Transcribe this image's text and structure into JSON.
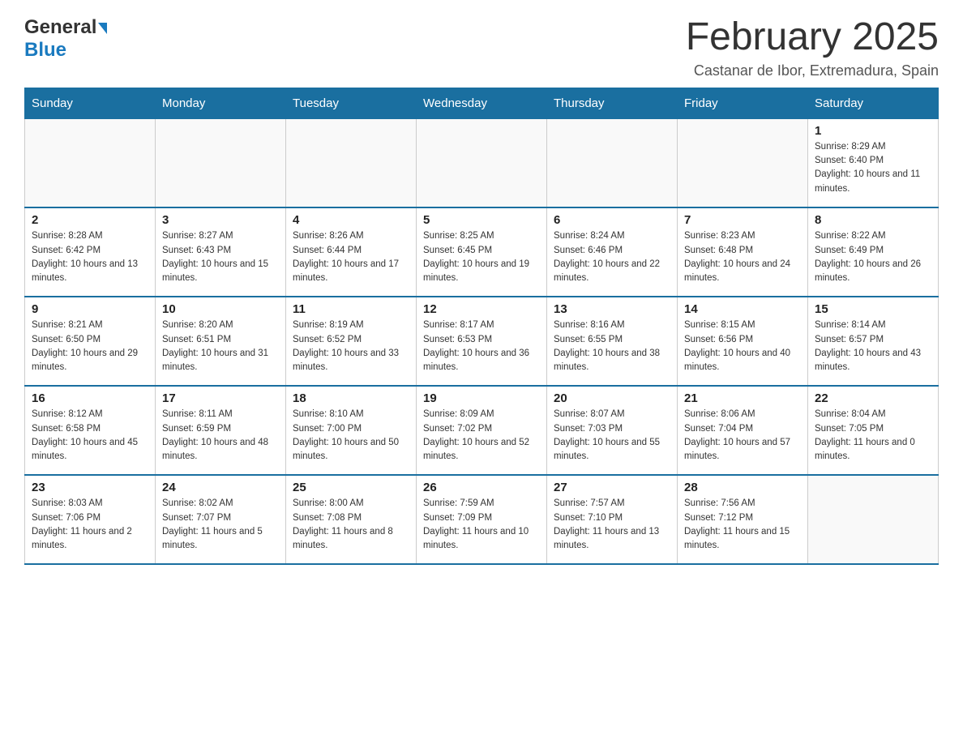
{
  "header": {
    "logo_general": "General",
    "logo_blue": "Blue",
    "title": "February 2025",
    "subtitle": "Castanar de Ibor, Extremadura, Spain"
  },
  "weekdays": [
    "Sunday",
    "Monday",
    "Tuesday",
    "Wednesday",
    "Thursday",
    "Friday",
    "Saturday"
  ],
  "weeks": [
    [
      {
        "day": "",
        "info": ""
      },
      {
        "day": "",
        "info": ""
      },
      {
        "day": "",
        "info": ""
      },
      {
        "day": "",
        "info": ""
      },
      {
        "day": "",
        "info": ""
      },
      {
        "day": "",
        "info": ""
      },
      {
        "day": "1",
        "info": "Sunrise: 8:29 AM\nSunset: 6:40 PM\nDaylight: 10 hours and 11 minutes."
      }
    ],
    [
      {
        "day": "2",
        "info": "Sunrise: 8:28 AM\nSunset: 6:42 PM\nDaylight: 10 hours and 13 minutes."
      },
      {
        "day": "3",
        "info": "Sunrise: 8:27 AM\nSunset: 6:43 PM\nDaylight: 10 hours and 15 minutes."
      },
      {
        "day": "4",
        "info": "Sunrise: 8:26 AM\nSunset: 6:44 PM\nDaylight: 10 hours and 17 minutes."
      },
      {
        "day": "5",
        "info": "Sunrise: 8:25 AM\nSunset: 6:45 PM\nDaylight: 10 hours and 19 minutes."
      },
      {
        "day": "6",
        "info": "Sunrise: 8:24 AM\nSunset: 6:46 PM\nDaylight: 10 hours and 22 minutes."
      },
      {
        "day": "7",
        "info": "Sunrise: 8:23 AM\nSunset: 6:48 PM\nDaylight: 10 hours and 24 minutes."
      },
      {
        "day": "8",
        "info": "Sunrise: 8:22 AM\nSunset: 6:49 PM\nDaylight: 10 hours and 26 minutes."
      }
    ],
    [
      {
        "day": "9",
        "info": "Sunrise: 8:21 AM\nSunset: 6:50 PM\nDaylight: 10 hours and 29 minutes."
      },
      {
        "day": "10",
        "info": "Sunrise: 8:20 AM\nSunset: 6:51 PM\nDaylight: 10 hours and 31 minutes."
      },
      {
        "day": "11",
        "info": "Sunrise: 8:19 AM\nSunset: 6:52 PM\nDaylight: 10 hours and 33 minutes."
      },
      {
        "day": "12",
        "info": "Sunrise: 8:17 AM\nSunset: 6:53 PM\nDaylight: 10 hours and 36 minutes."
      },
      {
        "day": "13",
        "info": "Sunrise: 8:16 AM\nSunset: 6:55 PM\nDaylight: 10 hours and 38 minutes."
      },
      {
        "day": "14",
        "info": "Sunrise: 8:15 AM\nSunset: 6:56 PM\nDaylight: 10 hours and 40 minutes."
      },
      {
        "day": "15",
        "info": "Sunrise: 8:14 AM\nSunset: 6:57 PM\nDaylight: 10 hours and 43 minutes."
      }
    ],
    [
      {
        "day": "16",
        "info": "Sunrise: 8:12 AM\nSunset: 6:58 PM\nDaylight: 10 hours and 45 minutes."
      },
      {
        "day": "17",
        "info": "Sunrise: 8:11 AM\nSunset: 6:59 PM\nDaylight: 10 hours and 48 minutes."
      },
      {
        "day": "18",
        "info": "Sunrise: 8:10 AM\nSunset: 7:00 PM\nDaylight: 10 hours and 50 minutes."
      },
      {
        "day": "19",
        "info": "Sunrise: 8:09 AM\nSunset: 7:02 PM\nDaylight: 10 hours and 52 minutes."
      },
      {
        "day": "20",
        "info": "Sunrise: 8:07 AM\nSunset: 7:03 PM\nDaylight: 10 hours and 55 minutes."
      },
      {
        "day": "21",
        "info": "Sunrise: 8:06 AM\nSunset: 7:04 PM\nDaylight: 10 hours and 57 minutes."
      },
      {
        "day": "22",
        "info": "Sunrise: 8:04 AM\nSunset: 7:05 PM\nDaylight: 11 hours and 0 minutes."
      }
    ],
    [
      {
        "day": "23",
        "info": "Sunrise: 8:03 AM\nSunset: 7:06 PM\nDaylight: 11 hours and 2 minutes."
      },
      {
        "day": "24",
        "info": "Sunrise: 8:02 AM\nSunset: 7:07 PM\nDaylight: 11 hours and 5 minutes."
      },
      {
        "day": "25",
        "info": "Sunrise: 8:00 AM\nSunset: 7:08 PM\nDaylight: 11 hours and 8 minutes."
      },
      {
        "day": "26",
        "info": "Sunrise: 7:59 AM\nSunset: 7:09 PM\nDaylight: 11 hours and 10 minutes."
      },
      {
        "day": "27",
        "info": "Sunrise: 7:57 AM\nSunset: 7:10 PM\nDaylight: 11 hours and 13 minutes."
      },
      {
        "day": "28",
        "info": "Sunrise: 7:56 AM\nSunset: 7:12 PM\nDaylight: 11 hours and 15 minutes."
      },
      {
        "day": "",
        "info": ""
      }
    ]
  ]
}
